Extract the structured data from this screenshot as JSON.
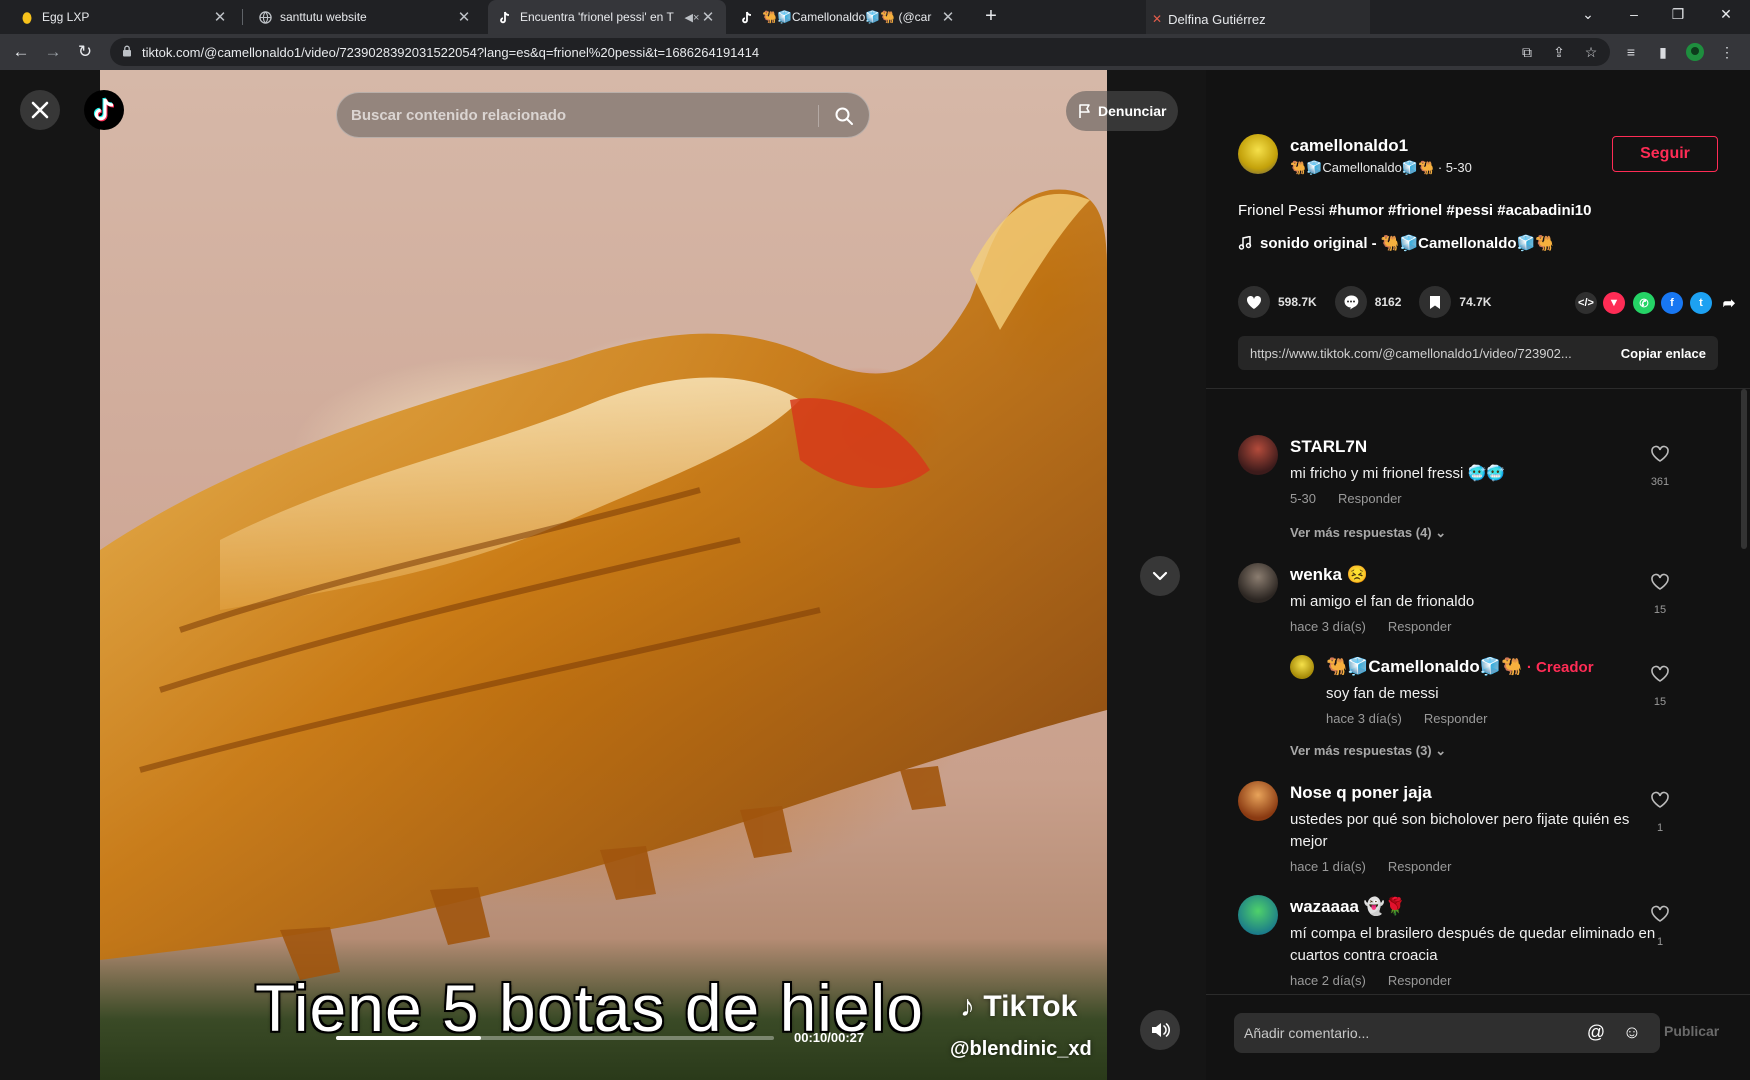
{
  "browser": {
    "tabs": [
      {
        "title": "Egg LXP",
        "icon": "egg-icon"
      },
      {
        "title": "santtutu website",
        "icon": "globe-icon"
      },
      {
        "title": "Encuentra 'frionel pessi' en T",
        "icon": "tiktok-icon",
        "muted": true
      },
      {
        "title": "🐫🧊Camellonaldo🧊🐫 (@car",
        "icon": "tiktok-icon"
      }
    ],
    "profile_tip": "Delfina Gutiérrez",
    "url": "tiktok.com/@camellonaldo1/video/7239028392031522054?lang=es&q=frionel%20pessi&t=1686264191414"
  },
  "video": {
    "search_placeholder": "Buscar contenido relacionado",
    "report_label": "Denunciar",
    "caption": "Tiene 5 botas de hielo",
    "watermark_brand": "TikTok",
    "watermark_user": "@blendinic_xd",
    "time": "00:10/00:27",
    "progress_fraction": 0.33
  },
  "post": {
    "author": "camellonaldo1",
    "author_display": "🐫🧊Camellonaldo🧊🐫 · 5-30",
    "follow_label": "Seguir",
    "description_text": "Frionel Pessi ",
    "hashtags": "#humor #frionel #pessi #acabadini10",
    "music": "sonido original - 🐫🧊Camellonaldo🧊🐫",
    "likes": "598.7K",
    "comments": "8162",
    "saves": "74.7K",
    "link": "https://www.tiktok.com/@camellonaldo1/video/723902...",
    "copy_label": "Copiar enlace"
  },
  "comments": [
    {
      "name": "STARL7N",
      "text": "mi fricho y mi frionel fressi 🥶🥶",
      "date": "5-30",
      "reply": "Responder",
      "likes": "361",
      "more": "Ver más respuestas (4)"
    },
    {
      "name": "wenka 😣",
      "text": "mi amigo el fan de frionaldo",
      "date": "hace 3 día(s)",
      "reply": "Responder",
      "likes": "15"
    },
    {
      "name": "🐫🧊Camellonaldo🧊🐫",
      "creator_label": "· Creador",
      "text": "soy fan de messi",
      "date": "hace 3 día(s)",
      "reply": "Responder",
      "likes": "15",
      "more": "Ver más respuestas (3)"
    },
    {
      "name": "Nose q poner jaja",
      "text": "ustedes por qué son bicholover pero fijate quién es mejor",
      "date": "hace 1 día(s)",
      "reply": "Responder",
      "likes": "1"
    },
    {
      "name": "wazaaaa 👻🌹",
      "text": "mí compa el brasilero después de quedar eliminado en cuartos contra croacia",
      "date": "hace 2 día(s)",
      "reply": "Responder",
      "likes": "1"
    }
  ],
  "footer": {
    "placeholder": "Añadir comentario...",
    "publish_label": "Publicar"
  },
  "colors": {
    "accent": "#fe2c55",
    "panel_bg": "#121212"
  }
}
